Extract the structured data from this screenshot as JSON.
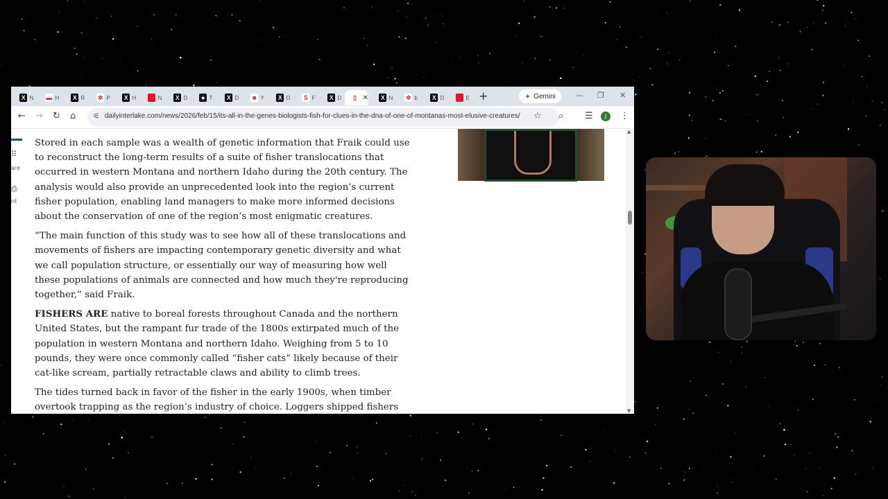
{
  "tabs": [
    {
      "icon": "x-logo-icon",
      "label": "N",
      "bg": "#000000",
      "glyph": "X"
    },
    {
      "icon": "doc-icon",
      "label": "H",
      "bg": "#ffffff",
      "glyph": "▬"
    },
    {
      "icon": "x-logo-icon",
      "label": "R",
      "bg": "#000000",
      "glyph": "X"
    },
    {
      "icon": "pinwheel-icon",
      "label": "P",
      "bg": "#ffffff",
      "glyph": "✲"
    },
    {
      "icon": "x-logo-icon",
      "label": "H",
      "bg": "#000000",
      "glyph": "X"
    },
    {
      "icon": "red-square-icon",
      "label": "N",
      "bg": "#e8102a",
      "glyph": ""
    },
    {
      "icon": "x-logo-icon",
      "label": "D",
      "bg": "#000000",
      "glyph": "X"
    },
    {
      "icon": "circle-logo-icon",
      "label": "T",
      "bg": "#1a1a1a",
      "glyph": "●"
    },
    {
      "icon": "x-logo-icon",
      "label": "D",
      "bg": "#000000",
      "glyph": "X"
    },
    {
      "icon": "person-icon",
      "label": "Y",
      "bg": "#ffffff",
      "glyph": "☻"
    },
    {
      "icon": "x-logo-icon",
      "label": "D",
      "bg": "#000000",
      "glyph": "X"
    },
    {
      "icon": "s-logo-icon",
      "label": "F",
      "bg": "#ffffff",
      "glyph": "S"
    },
    {
      "icon": "x-logo-icon",
      "label": "D",
      "bg": "#000000",
      "glyph": "X"
    },
    {
      "icon": "page-icon",
      "label": "",
      "bg": "#ffffff",
      "glyph": "▯",
      "active": true
    },
    {
      "icon": "x-logo-icon",
      "label": "N",
      "bg": "#000000",
      "glyph": "X"
    },
    {
      "icon": "pinwheel-icon",
      "label": "b",
      "bg": "#ffffff",
      "glyph": "✲"
    },
    {
      "icon": "x-logo-icon",
      "label": "D",
      "bg": "#000000",
      "glyph": "X"
    },
    {
      "icon": "red-square-icon",
      "label": "E",
      "bg": "#e8102a",
      "glyph": ""
    }
  ],
  "gemini_label": "Gemini",
  "url": "dailyinterlake.com/news/2026/feb/15/its-all-in-the-genes-biologists-fish-for-clues-in-the-dna-of-one-of-montanas-most-elusive-creatures/",
  "profile_initial": "J",
  "sidebar": {
    "share_fragment": "are",
    "print_fragment": "nt"
  },
  "article": {
    "top_fragment": "y",
    "p1": "Stored in each sample was a wealth of genetic information that Fraik could use to reconstruct the long-term results of a suite of fisher translocations that occurred in western Montana and northern Idaho during the 20th century. The analysis would also provide an unprecedented look into the region’s current fisher population, enabling land managers to make more informed decisions about the conservation of one of the region’s most enigmatic creatures.",
    "p2": "“The main function of this study was to see how all of these translocations and movements of fishers are impacting contemporary genetic diversity and what we call population structure, or essentially our way of measuring how well these populations of animals are connected and how much they're reproducing together,” said Fraik.",
    "p3_lead": "FISHERS ARE",
    "p3": " native to boreal forests throughout Canada and the northern United States, but the rampant fur trade of the 1800s extirpated much of the population in western Montana and northern Idaho. Weighing from 5 to 10 pounds, they were once commonly called “fisher cats” likely because of their cat-like scream, partially retractable claws and ability to climb trees.",
    "p4": "The tides turned back in favor of the fisher in the early 1900s, when timber overtook trapping as the region’s industry of choice. Loggers shipped fishers"
  }
}
